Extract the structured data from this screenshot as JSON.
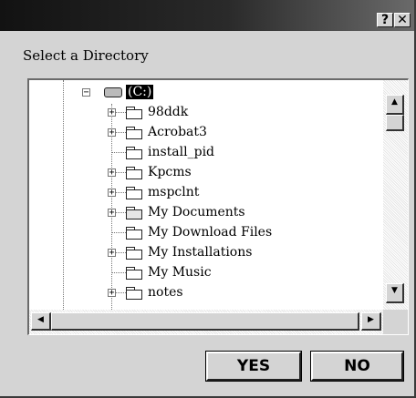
{
  "window": {
    "title": "",
    "help_button": "?",
    "close_button": "✕"
  },
  "prompt": "Select a Directory",
  "tree": {
    "root": {
      "label": "(C:)",
      "expander": "−",
      "icon": "drive-icon"
    },
    "items": [
      {
        "label": "98ddk",
        "expander": "+",
        "icon": "folder-icon"
      },
      {
        "label": "Acrobat3",
        "expander": "+",
        "icon": "folder-icon"
      },
      {
        "label": "install_pid",
        "expander": "",
        "icon": "folder-icon"
      },
      {
        "label": "Kpcms",
        "expander": "+",
        "icon": "folder-icon"
      },
      {
        "label": "mspclnt",
        "expander": "+",
        "icon": "folder-icon"
      },
      {
        "label": "My Documents",
        "expander": "+",
        "icon": "special-folder-icon"
      },
      {
        "label": "My Download Files",
        "expander": "",
        "icon": "folder-icon"
      },
      {
        "label": "My Installations",
        "expander": "+",
        "icon": "folder-icon"
      },
      {
        "label": "My Music",
        "expander": "",
        "icon": "folder-icon"
      },
      {
        "label": "notes",
        "expander": "+",
        "icon": "folder-icon"
      }
    ]
  },
  "scrollbars": {
    "up_arrow": "▲",
    "down_arrow": "▼",
    "left_arrow": "◀",
    "right_arrow": "▶"
  },
  "buttons": {
    "yes": "YES",
    "no": "NO"
  }
}
